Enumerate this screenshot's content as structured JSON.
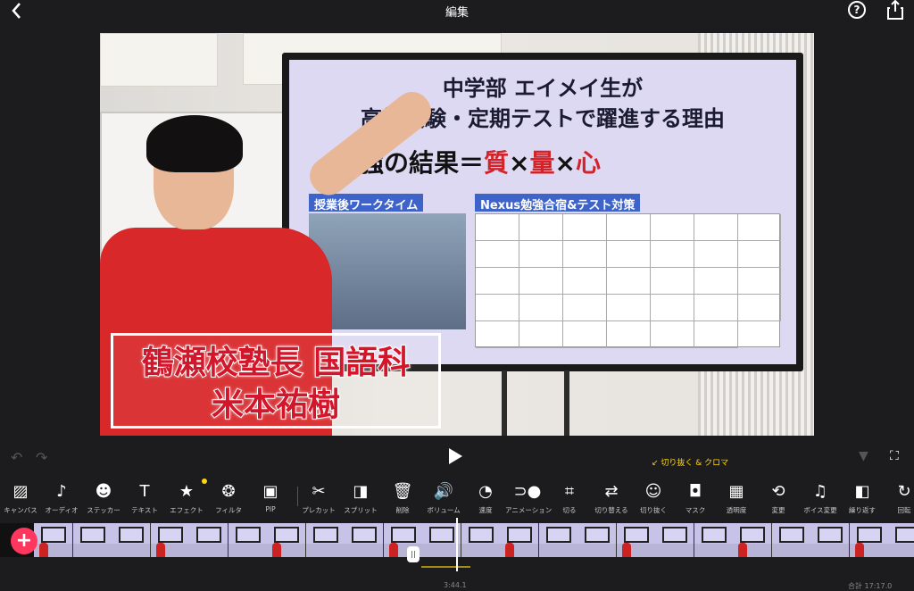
{
  "header": {
    "title": "編集",
    "back_icon": "chevron-left-icon",
    "help_icon": "help-circle-icon",
    "share_icon": "share-icon"
  },
  "preview": {
    "screen_line1": "中学部 エイメイ生が",
    "screen_line2": "高校受験・定期テストで躍進する理由",
    "screen_line3_a": "勉強の結果＝",
    "screen_line3_b": "質",
    "screen_line3_c": "×",
    "screen_line3_d": "量",
    "screen_line3_e": "×",
    "screen_line3_f": "心",
    "tag_left": "授業後ワークタイム",
    "tag_right": "Nexus勉強合宿&テスト対策",
    "caption_line1": "鶴瀬校塾長 国語科",
    "caption_line2": "米本祐樹"
  },
  "controls": {
    "undo_icon": "undo-icon",
    "redo_icon": "redo-icon",
    "play_icon": "play-icon",
    "keyframe_icon": "keyframe-icon",
    "fullscreen_icon": "fullscreen-icon",
    "hint": "切り抜く & クロマ"
  },
  "toolbar": [
    {
      "label": "キャンバス",
      "icon": "canvas-icon",
      "glyph": "▨"
    },
    {
      "label": "オーディオ",
      "icon": "music-note-icon",
      "glyph": "♪"
    },
    {
      "label": "ステッカー",
      "icon": "smiley-icon",
      "glyph": "☻"
    },
    {
      "label": "テキスト",
      "icon": "text-icon",
      "glyph": "T"
    },
    {
      "label": "エフェクト",
      "icon": "star-icon",
      "glyph": "★"
    },
    {
      "label": "フィルタ",
      "icon": "filter-icon",
      "glyph": "❂"
    },
    {
      "label": "PIP",
      "icon": "pip-icon",
      "glyph": "▣"
    },
    {
      "label": "プレカット",
      "icon": "scissors-icon",
      "glyph": "✂"
    },
    {
      "label": "スプリット",
      "icon": "split-icon",
      "glyph": "◨"
    },
    {
      "label": "削除",
      "icon": "trash-icon",
      "glyph": "🗑"
    },
    {
      "label": "ボリューム",
      "icon": "volume-icon",
      "glyph": "🔊"
    },
    {
      "label": "速度",
      "icon": "speed-icon",
      "glyph": "◔"
    },
    {
      "label": "アニメーション",
      "icon": "animation-icon",
      "glyph": "⊃●"
    },
    {
      "label": "切る",
      "icon": "crop-icon",
      "glyph": "⌗"
    },
    {
      "label": "切り替える",
      "icon": "shuffle-icon",
      "glyph": "⇄"
    },
    {
      "label": "切り抜く",
      "icon": "cutout-person-icon",
      "glyph": "☺"
    },
    {
      "label": "マスク",
      "icon": "mask-icon",
      "glyph": "◘"
    },
    {
      "label": "透明度",
      "icon": "opacity-icon",
      "glyph": "▦"
    },
    {
      "label": "変更",
      "icon": "replace-icon",
      "glyph": "⟲"
    },
    {
      "label": "ボイス変更",
      "icon": "voice-change-icon",
      "glyph": "♫"
    },
    {
      "label": "繰り返す",
      "icon": "repeat-icon",
      "glyph": "◧"
    },
    {
      "label": "回転",
      "icon": "rotate-icon",
      "glyph": "↻"
    }
  ],
  "timeline": {
    "add_label": "+",
    "current_time": "3:44.1",
    "total": "合計 17:17.0",
    "frame_count": 23
  }
}
